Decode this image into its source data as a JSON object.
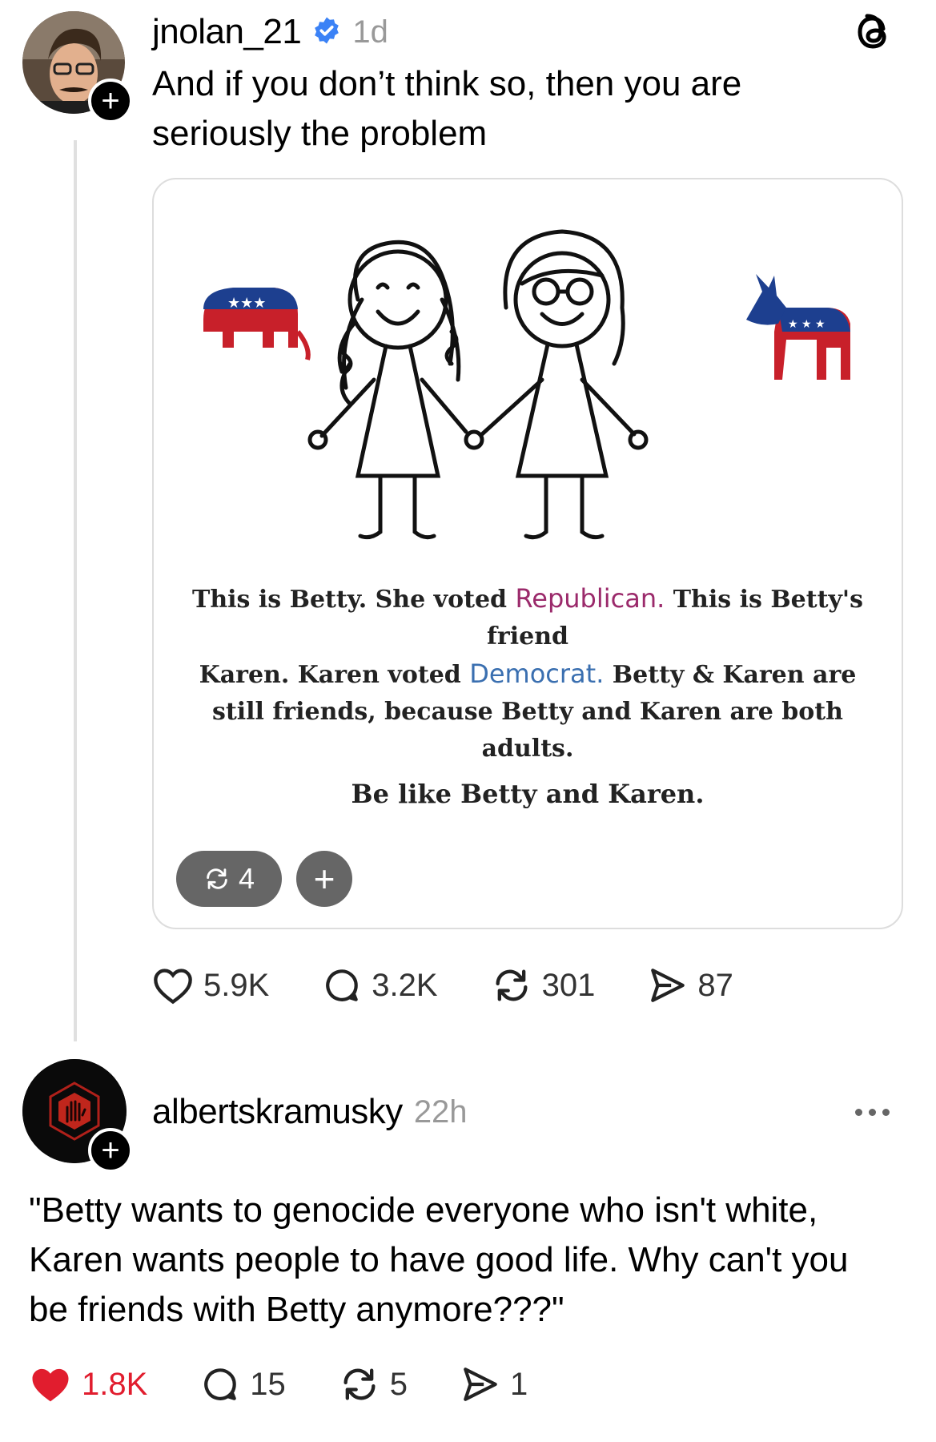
{
  "post": {
    "username": "jnolan_21",
    "time": "1d",
    "text_line1": "And if you don’t think so, then you are",
    "text_line2": "seriously the problem",
    "image": {
      "caption_1a": "This is Betty. She voted ",
      "caption_republican": "Republican.",
      "caption_1b": " This is Betty's friend",
      "caption_2a": "Karen. Karen voted ",
      "caption_democrat": "Democrat.",
      "caption_2b": " Betty & Karen are",
      "caption_3": "still friends, because Betty and Karen are both",
      "caption_4": "adults.",
      "caption_5": "Be like Betty and Karen.",
      "repost_count": "4"
    },
    "stats": {
      "likes": "5.9K",
      "replies": "3.2K",
      "reposts": "301",
      "shares": "87"
    }
  },
  "reply": {
    "username": "albertskramusky",
    "time": "22h",
    "text_line1": "\"Betty wants to genocide everyone who isn't white,",
    "text_line2": "Karen wants people to have good life. Why can't you",
    "text_line3": "be friends with Betty anymore???\"",
    "stats": {
      "likes": "1.8K",
      "replies": "15",
      "reposts": "5",
      "shares": "1"
    }
  },
  "colors": {
    "verified": "#3b82f6",
    "liked": "#e11d2e",
    "republican": "#9b2a6b",
    "democrat": "#3a6fb0"
  }
}
